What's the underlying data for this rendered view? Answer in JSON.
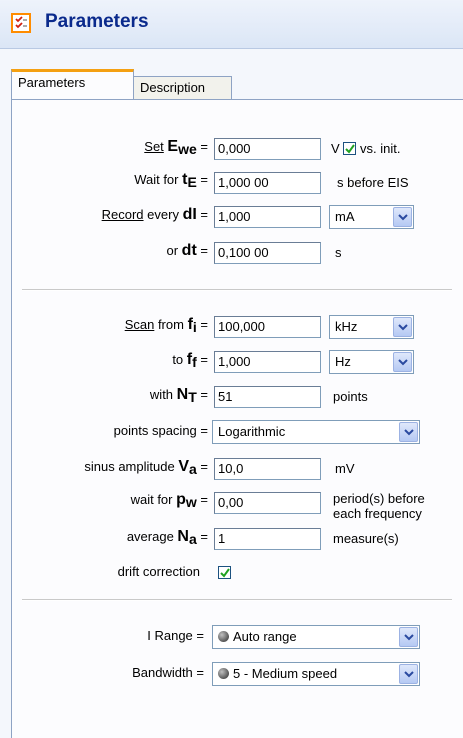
{
  "header": {
    "title": "Parameters",
    "icon": "checklist-icon"
  },
  "tabs": [
    {
      "label": "Parameters",
      "active": true
    },
    {
      "label": "Description",
      "active": false
    }
  ],
  "rows": {
    "ewe": {
      "link": "Set",
      "sym": "E",
      "sub": "we",
      "eq": " =",
      "value": "0,000",
      "unit": "V",
      "vs_checked": true,
      "vs_label": "vs. init."
    },
    "te": {
      "pre": "Wait for ",
      "sym": "t",
      "sub": "E",
      "eq": " =",
      "value": "1,000 00",
      "unit": "s  before EIS"
    },
    "di": {
      "link": "Record",
      "pre": " every ",
      "sym": "dI",
      "eq": " =",
      "value": "1,000",
      "unit_select": "mA"
    },
    "dt": {
      "pre": "or ",
      "sym": "dt",
      "eq": " =",
      "value": "0,100 00",
      "unit": "s"
    },
    "fi": {
      "link": "Scan",
      "pre": "  from ",
      "sym": "f",
      "sub": "i",
      "eq": " =",
      "value": "100,000",
      "unit_select": "kHz"
    },
    "ff": {
      "pre": "to ",
      "sym": "f",
      "sub": "f",
      "eq": " =",
      "value": "1,000",
      "unit_select": "Hz"
    },
    "nt": {
      "pre": "with ",
      "sym": "N",
      "sub": "T",
      "eq": " =",
      "value": "51",
      "unit": "points"
    },
    "spacing": {
      "pre": "points spacing =",
      "value": "Logarithmic"
    },
    "va": {
      "pre": "sinus amplitude ",
      "sym": "V",
      "sub": "a",
      "eq": " =",
      "value": "10,0",
      "unit": "mV"
    },
    "pw": {
      "pre": "wait for ",
      "sym": "p",
      "sub": "w",
      "eq": " =",
      "value": "0,00",
      "unit_line1": "period(s) before",
      "unit_line2": "each frequency"
    },
    "na": {
      "pre": "average ",
      "sym": "N",
      "sub": "a",
      "eq": " =",
      "value": "1",
      "unit": "measure(s)"
    },
    "drift": {
      "label": "drift correction",
      "checked": true
    },
    "irange": {
      "label": "I Range  =",
      "value": "Auto range"
    },
    "bandwidth": {
      "label": "Bandwidth  =",
      "value": "5 - Medium speed"
    }
  }
}
